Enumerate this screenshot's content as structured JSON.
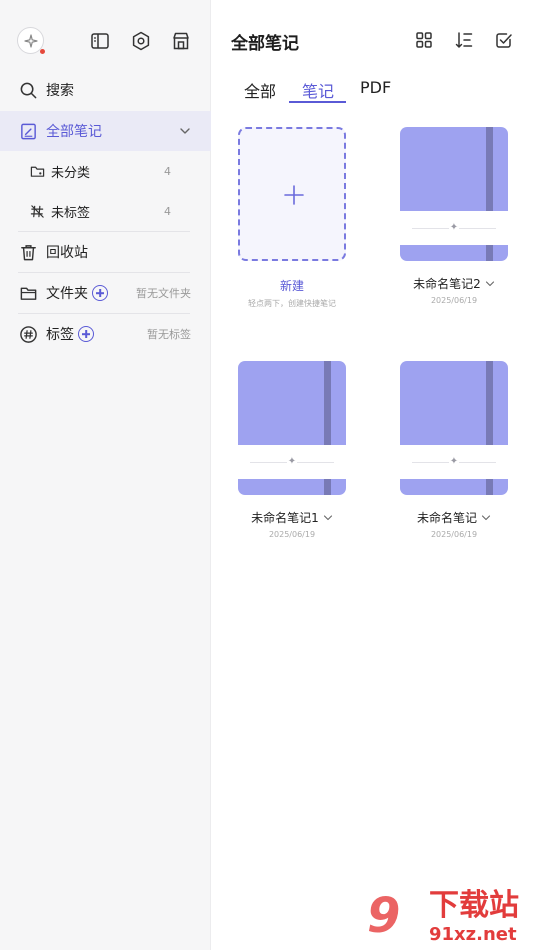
{
  "sidebar": {
    "items": [
      {
        "label": "搜索"
      },
      {
        "label": "全部笔记"
      },
      {
        "label": "未分类",
        "count": "4"
      },
      {
        "label": "未标签",
        "count": "4"
      },
      {
        "label": "回收站"
      },
      {
        "label": "文件夹",
        "hint": "暂无文件夹"
      },
      {
        "label": "标签",
        "hint": "暂无标签"
      }
    ]
  },
  "main": {
    "title": "全部笔记",
    "tabs": [
      {
        "label": "全部"
      },
      {
        "label": "笔记"
      },
      {
        "label": "PDF"
      }
    ],
    "new_card": {
      "title": "新建",
      "subtitle": "轻点两下，创建快捷笔记"
    },
    "notes": [
      {
        "title": "未命名笔记2",
        "date": "2025/06/19"
      },
      {
        "title": "未命名笔记1",
        "date": "2025/06/19"
      },
      {
        "title": "未命名笔记",
        "date": "2025/06/19"
      }
    ]
  },
  "watermark": {
    "brand": "下载站",
    "domain": "91xz.net",
    "logo": "9"
  },
  "colors": {
    "accent": "#5a5ad6",
    "notebook": "#9ea2f0",
    "notebook_band": "#787ab6",
    "sidebar_bg": "#f6f6f7"
  }
}
